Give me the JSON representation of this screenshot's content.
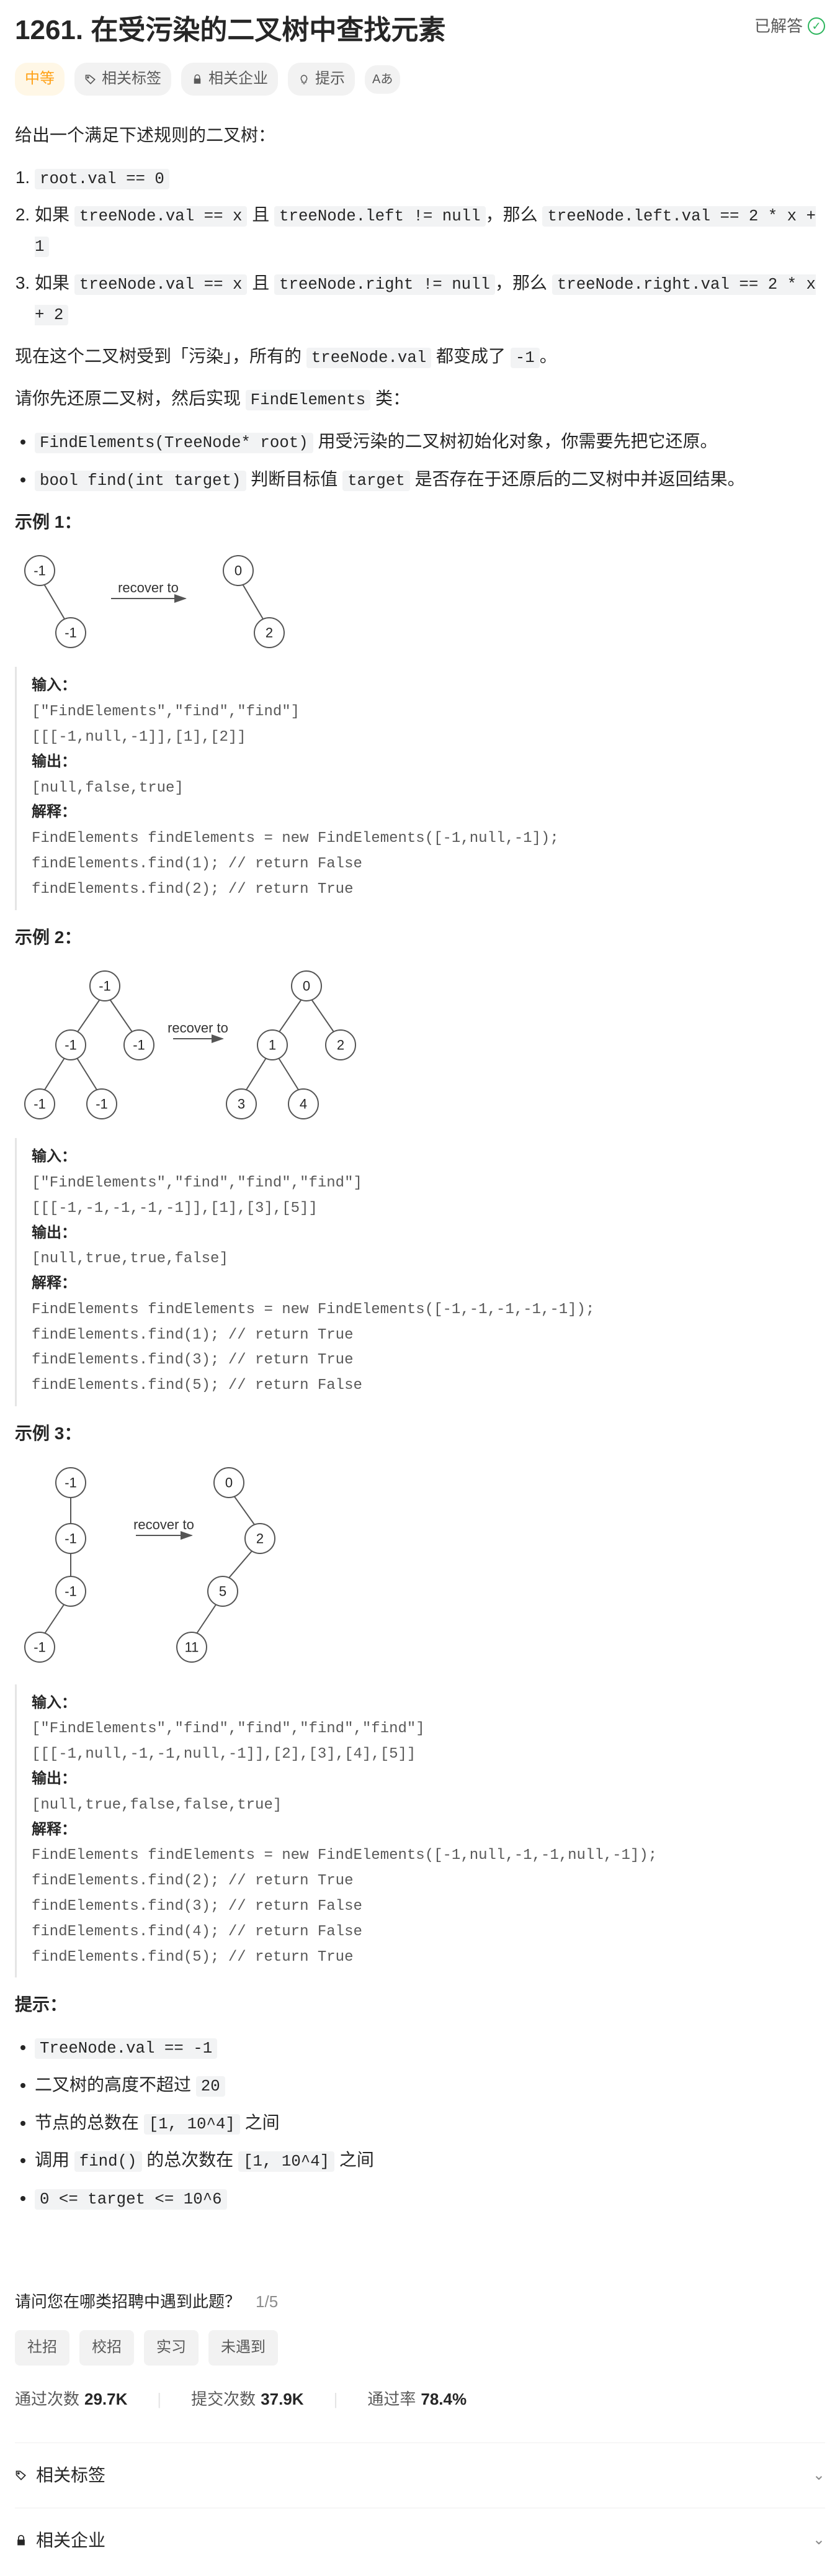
{
  "header": {
    "title": "1261. 在受污染的二叉树中查找元素",
    "solved_label": "已解答"
  },
  "badges": {
    "difficulty": "中等",
    "tags": "相关标签",
    "companies": "相关企业",
    "hint": "提示"
  },
  "description": {
    "intro": "给出一个满足下述规则的二叉树：",
    "rules": [
      {
        "pre": "",
        "code1": "root.val == 0",
        "mid": "",
        "code2": "",
        "post": ""
      },
      {
        "pre": "如果 ",
        "code1": "treeNode.val == x",
        "mid": " 且 ",
        "code2": "treeNode.left != null",
        "mid2": "，那么 ",
        "code3": "treeNode.left.val == 2 * x + 1"
      },
      {
        "pre": "如果 ",
        "code1": "treeNode.val == x",
        "mid": " 且 ",
        "code2": "treeNode.right != null",
        "mid2": "，那么 ",
        "code3": "treeNode.right.val == 2 * x + 2"
      }
    ],
    "polluted_pre": "现在这个二叉树受到「污染」，所有的 ",
    "polluted_code": "treeNode.val",
    "polluted_mid": " 都变成了 ",
    "polluted_code2": "-1",
    "polluted_post": "。",
    "recover_pre": "请你先还原二叉树，然后实现 ",
    "recover_code": "FindElements",
    "recover_post": " 类：",
    "methods": [
      {
        "code": "FindElements(TreeNode* root)",
        "desc": " 用受污染的二叉树初始化对象，你需要先把它还原。"
      },
      {
        "code": "bool find(int target)",
        "desc_pre": " 判断目标值 ",
        "desc_code": "target",
        "desc_post": " 是否存在于还原后的二叉树中并返回结果。"
      }
    ]
  },
  "examples": {
    "e1": {
      "title": "示例 1：",
      "recover": "recover to",
      "block": "输入：\n[\"FindElements\",\"find\",\"find\"]\n[[[-1,null,-1]],[1],[2]]\n输出：\n[null,false,true]\n解释：\nFindElements findElements = new FindElements([-1,null,-1]); \nfindElements.find(1); // return False \nfindElements.find(2); // return True "
    },
    "e2": {
      "title": "示例 2：",
      "recover": "recover to",
      "block": "输入：\n[\"FindElements\",\"find\",\"find\",\"find\"]\n[[[-1,-1,-1,-1,-1]],[1],[3],[5]]\n输出：\n[null,true,true,false]\n解释：\nFindElements findElements = new FindElements([-1,-1,-1,-1,-1]);\nfindElements.find(1); // return True\nfindElements.find(3); // return True\nfindElements.find(5); // return False"
    },
    "e3": {
      "title": "示例 3：",
      "recover": "recover to",
      "block": "输入：\n[\"FindElements\",\"find\",\"find\",\"find\",\"find\"]\n[[[-1,null,-1,-1,null,-1]],[2],[3],[4],[5]]\n输出：\n[null,true,false,false,true]\n解释：\nFindElements findElements = new FindElements([-1,null,-1,-1,null,-1]);\nfindElements.find(2); // return True\nfindElements.find(3); // return False\nfindElements.find(4); // return False\nfindElements.find(5); // return True"
    }
  },
  "constraints": {
    "title": "提示：",
    "items": [
      {
        "code": "TreeNode.val == -1"
      },
      {
        "pre": "二叉树的高度不超过 ",
        "code": "20"
      },
      {
        "pre": "节点的总数在 ",
        "code": "[1, 10^4]",
        "post": " 之间"
      },
      {
        "pre": "调用 ",
        "code": "find()",
        "mid": " 的总次数在 ",
        "code2": "[1, 10^4]",
        "post": " 之间"
      },
      {
        "code": "0 <= target <= 10^6"
      }
    ]
  },
  "survey": {
    "question": "请问您在哪类招聘中遇到此题？",
    "page": "1/5",
    "options": [
      "社招",
      "校招",
      "实习",
      "未遇到"
    ]
  },
  "stats": {
    "accepted_label": "通过次数",
    "accepted": "29.7K",
    "submissions_label": "提交次数",
    "submissions": "37.9K",
    "rate_label": "通过率",
    "rate": "78.4%"
  },
  "expand": {
    "tags": "相关标签",
    "companies": "相关企业"
  },
  "labels": {
    "input": "输入：",
    "output": "输出：",
    "explain": "解释："
  }
}
